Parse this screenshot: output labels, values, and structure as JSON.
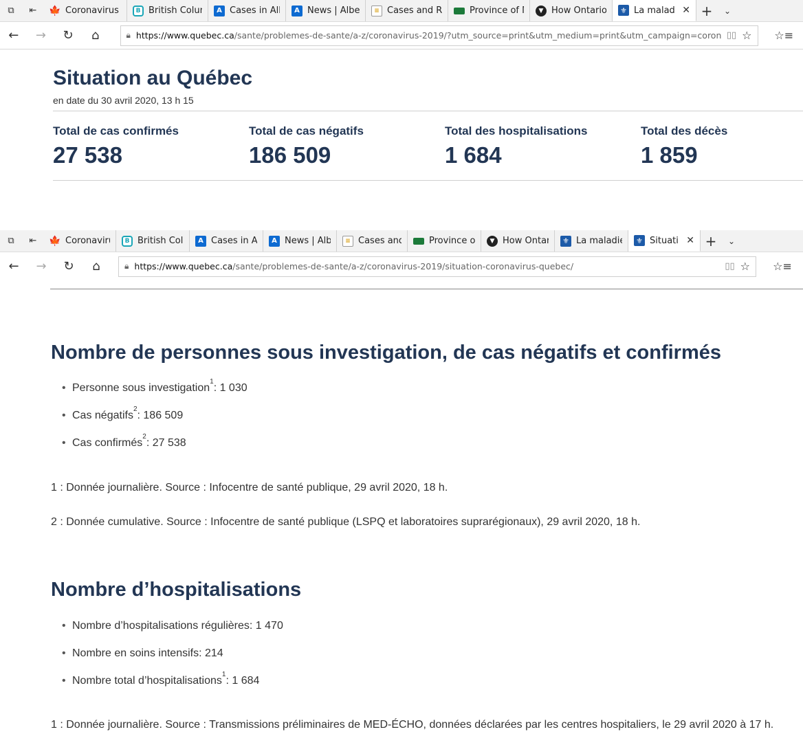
{
  "window1": {
    "tabs": [
      {
        "label": "Coronavirus c",
        "icon": "maple-leaf-icon"
      },
      {
        "label": "British Colum",
        "icon": "bc-icon"
      },
      {
        "label": "Cases in Albe",
        "icon": "alberta-icon"
      },
      {
        "label": "News | Albert",
        "icon": "alberta-icon"
      },
      {
        "label": "Cases and Ris",
        "icon": "document-icon"
      },
      {
        "label": "Province of M",
        "icon": "manitoba-icon"
      },
      {
        "label": "How Ontario",
        "icon": "ontario-icon"
      },
      {
        "label": "La maladi",
        "icon": "quebec-icon",
        "active": true
      }
    ],
    "url_host": "https://www.quebec.ca",
    "url_path": "/sante/problemes-de-sante/a-z/coronavirus-2019/?utm_source=print&utm_medium=print&utm_campaign=coronavirus",
    "page": {
      "title": "Situation au Québec",
      "date": "en date du 30 avril 2020, 13 h 15",
      "stats": [
        {
          "label": "Total de cas confirmés",
          "value": "27 538"
        },
        {
          "label": "Total de cas négatifs",
          "value": "186 509"
        },
        {
          "label": "Total des hospitalisations",
          "value": "1 684"
        },
        {
          "label": "Total des décès",
          "value": "1 859"
        }
      ]
    }
  },
  "window2": {
    "tabs": [
      {
        "label": "Coronaviru",
        "icon": "maple-leaf-icon"
      },
      {
        "label": "British Colu",
        "icon": "bc-icon"
      },
      {
        "label": "Cases in All",
        "icon": "alberta-icon"
      },
      {
        "label": "News | Albe",
        "icon": "alberta-icon"
      },
      {
        "label": "Cases and F",
        "icon": "document-icon"
      },
      {
        "label": "Province of",
        "icon": "manitoba-icon"
      },
      {
        "label": "How Ontari",
        "icon": "ontario-icon"
      },
      {
        "label": "La maladie",
        "icon": "quebec-icon"
      },
      {
        "label": "Situatic",
        "icon": "quebec-icon",
        "active": true
      }
    ],
    "url_host": "https://www.quebec.ca",
    "url_path": "/sante/problemes-de-sante/a-z/coronavirus-2019/situation-coronavirus-quebec/",
    "section1": {
      "heading": "Nombre de personnes sous investigation, de cas négatifs et confirmés",
      "items": [
        {
          "label": "Personne sous investigation",
          "sup": "1",
          "value": " : 1 030"
        },
        {
          "label": "Cas négatifs",
          "sup": "2",
          "value": " : 186 509"
        },
        {
          "label": "Cas confirmés",
          "sup": "2",
          "value": " : 27 538"
        }
      ],
      "note1": "1 : Donnée journalière. Source : Infocentre de santé publique, 29 avril 2020, 18 h.",
      "note2": "2 : Donnée cumulative. Source : Infocentre de santé publique (LSPQ et laboratoires suprarégionaux), 29 avril 2020, 18 h."
    },
    "section2": {
      "heading": "Nombre d’hospitalisations",
      "items": [
        {
          "label": "Nombre d’hospitalisations régulières",
          "sup": "",
          "value": " : 1 470"
        },
        {
          "label": "Nombre en soins intensifs",
          "sup": "",
          "value": " : 214"
        },
        {
          "label": "Nombre total d’hospitalisations",
          "sup": "1",
          "value": " : 1 684"
        }
      ],
      "note1": "1 : Donnée journalière. Source : Transmissions préliminaires de MED-ÉCHO, données déclarées par les centres hospitaliers, le 29 avril 2020 à 17 h."
    }
  },
  "icons": {
    "set_aside": "⧉",
    "restore_tabs": "⇤",
    "back": "←",
    "forward": "→",
    "refresh": "↻",
    "home": "⌂",
    "lock": "🔒",
    "reading_view": "📖",
    "favorite": "☆",
    "favorites_hub": "☆≡",
    "new_tab": "+",
    "tab_list": "⌄",
    "close": "✕"
  }
}
